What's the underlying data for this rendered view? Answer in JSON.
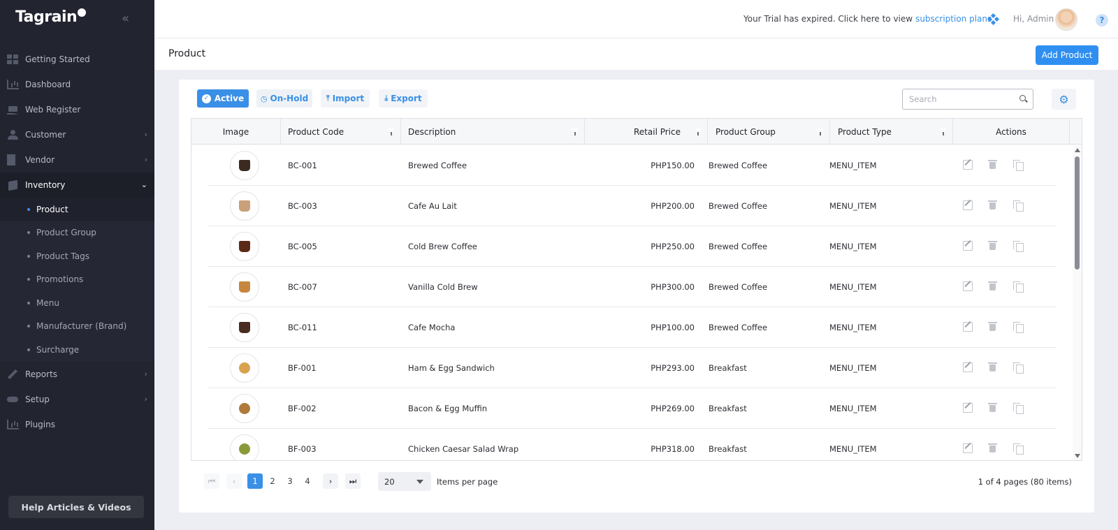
{
  "app": {
    "logo": "Tagrain"
  },
  "sidebar": {
    "items": [
      {
        "label": "Getting Started",
        "icon": "grid-icon"
      },
      {
        "label": "Dashboard",
        "icon": "chart-bars-icon"
      },
      {
        "label": "Web Register",
        "icon": "cart-icon"
      },
      {
        "label": "Customer",
        "icon": "user-icon"
      },
      {
        "label": "Vendor",
        "icon": "building-icon"
      },
      {
        "label": "Inventory",
        "icon": "box-icon"
      },
      {
        "label": "Reports",
        "icon": "pencil-icon"
      },
      {
        "label": "Setup",
        "icon": "toggle-icon"
      },
      {
        "label": "Plugins",
        "icon": "chart-bars-icon"
      }
    ],
    "inventory_sub": [
      {
        "label": "Product"
      },
      {
        "label": "Product Group"
      },
      {
        "label": "Product Tags"
      },
      {
        "label": "Promotions"
      },
      {
        "label": "Menu"
      },
      {
        "label": "Manufacturer (Brand)"
      },
      {
        "label": "Surcharge"
      }
    ],
    "help_label": "Help Articles & Videos"
  },
  "topbar": {
    "trial_text": "Your Trial has expired. Click here to view",
    "trial_link": "subscription plans.",
    "greeting": "Hi, Admin",
    "help": "?"
  },
  "page": {
    "title": "Product",
    "add_label": "Add Product"
  },
  "toolbar": {
    "active": "Active",
    "on_hold": "On-Hold",
    "import": "Import",
    "export": "Export",
    "search_placeholder": "Search"
  },
  "table": {
    "columns": [
      "Image",
      "Product Code",
      "Description",
      "Retail Price",
      "Product Group",
      "Product Type",
      "Actions"
    ],
    "rows": [
      {
        "code": "BC-001",
        "description": "Brewed Coffee",
        "price": "PHP150.00",
        "group": "Brewed Coffee",
        "type": "MENU_ITEM"
      },
      {
        "code": "BC-003",
        "description": "Cafe Au Lait",
        "price": "PHP200.00",
        "group": "Brewed Coffee",
        "type": "MENU_ITEM"
      },
      {
        "code": "BC-005",
        "description": "Cold Brew Coffee",
        "price": "PHP250.00",
        "group": "Brewed Coffee",
        "type": "MENU_ITEM"
      },
      {
        "code": "BC-007",
        "description": "Vanilla Cold Brew",
        "price": "PHP300.00",
        "group": "Brewed Coffee",
        "type": "MENU_ITEM"
      },
      {
        "code": "BC-011",
        "description": "Cafe Mocha",
        "price": "PHP100.00",
        "group": "Brewed Coffee",
        "type": "MENU_ITEM"
      },
      {
        "code": "BF-001",
        "description": "Ham & Egg Sandwich",
        "price": "PHP293.00",
        "group": "Breakfast",
        "type": "MENU_ITEM"
      },
      {
        "code": "BF-002",
        "description": "Bacon & Egg Muffin",
        "price": "PHP269.00",
        "group": "Breakfast",
        "type": "MENU_ITEM"
      },
      {
        "code": "BF-003",
        "description": "Chicken Caesar Salad Wrap",
        "price": "PHP318.00",
        "group": "Breakfast",
        "type": "MENU_ITEM"
      }
    ]
  },
  "pager": {
    "pages": [
      "1",
      "2",
      "3",
      "4"
    ],
    "current": "1",
    "per_page": "20",
    "per_page_label": "Items per page",
    "info": "1 of 4 pages (80 items)"
  },
  "colors": {
    "accent": "#3a8fe6",
    "sidebar_bg": "#22242f",
    "page_bg": "#eceef4"
  }
}
